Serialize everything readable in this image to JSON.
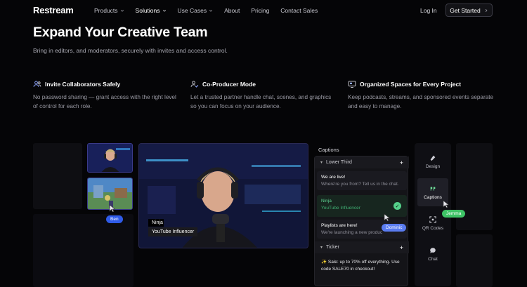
{
  "nav": {
    "logo": "Restream",
    "items": [
      {
        "label": "Products",
        "has_menu": true,
        "active": false
      },
      {
        "label": "Solutions",
        "has_menu": true,
        "active": true
      },
      {
        "label": "Use Cases",
        "has_menu": true,
        "active": false
      },
      {
        "label": "About",
        "has_menu": false,
        "active": false
      },
      {
        "label": "Pricing",
        "has_menu": false,
        "active": false
      },
      {
        "label": "Contact Sales",
        "has_menu": false,
        "active": false
      }
    ],
    "login": "Log In",
    "cta": "Get Started"
  },
  "hero": {
    "title": "Expand Your Creative Team",
    "subtitle": "Bring in editors, and moderators, securely with invites and access control."
  },
  "features": [
    {
      "icon": "users-icon",
      "title": "Invite Collaborators Safely",
      "desc": "No password sharing — grant access with the right level of control for each role."
    },
    {
      "icon": "user-check-icon",
      "title": "Co-Producer Mode",
      "desc": "Let a trusted partner handle chat, scenes, and graphics so you can focus on your audience."
    },
    {
      "icon": "monitor-icon",
      "title": "Organized Spaces for Every Project",
      "desc": "Keep podcasts, streams, and sponsored events separate and easy to manage."
    }
  ],
  "demo": {
    "name_tag": {
      "name": "Ninja",
      "role": "YouTube Influencer"
    },
    "captions": {
      "label": "Captions",
      "lower_third": "Lower Third",
      "ticker": "Ticker",
      "cards": [
        {
          "title": "We are live!",
          "sub": "Where're you from? Tell us in the chat."
        },
        {
          "title": "Ninja",
          "sub": "YouTube Influencer",
          "active": true
        },
        {
          "title": "Playlists are here!",
          "sub": "We're launching a new produc"
        }
      ],
      "ticker_text": "✨ Sale: up to 70% off everything. Use code SALE70 in checkout!"
    },
    "tools": [
      {
        "icon": "design-icon",
        "label": "Design"
      },
      {
        "icon": "quote-icon",
        "label": "Captions",
        "active": true
      },
      {
        "icon": "qr-icon",
        "label": "QR Codes"
      },
      {
        "icon": "chat-icon",
        "label": "Chat"
      }
    ],
    "cursors": [
      {
        "label": "Ben",
        "color": "#2f5be8"
      },
      {
        "label": "Dominic",
        "color": "#5a7cf0"
      },
      {
        "label": "Jemma",
        "color": "#3ec466"
      }
    ]
  },
  "colors": {
    "background": "#050507",
    "accent_green": "#54d18a",
    "accent_blue": "#2f5be8"
  }
}
